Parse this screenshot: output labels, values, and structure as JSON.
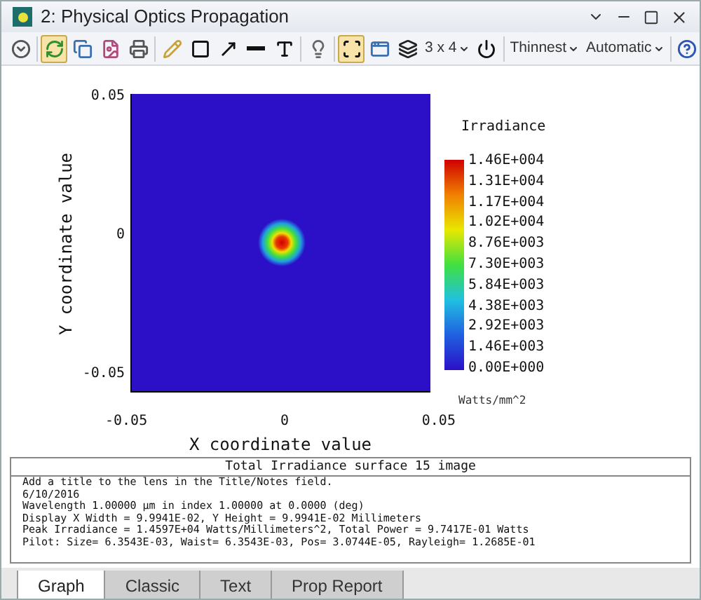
{
  "window": {
    "title": "2: Physical Optics Propagation"
  },
  "toolbar": [
    {
      "kind": "button",
      "selected": false
    },
    {
      "kind": "separator"
    },
    {
      "kind": "button",
      "selected": true
    },
    {
      "kind": "button",
      "selected": false
    },
    {
      "kind": "button",
      "selected": false
    },
    {
      "kind": "button",
      "selected": false
    },
    {
      "kind": "separator"
    },
    {
      "kind": "button",
      "selected": false
    },
    {
      "kind": "button",
      "selected": false
    },
    {
      "kind": "button",
      "selected": false
    },
    {
      "kind": "button",
      "selected": false
    },
    {
      "kind": "button",
      "selected": false
    },
    {
      "kind": "separator"
    },
    {
      "kind": "button",
      "selected": false
    },
    {
      "kind": "separator"
    },
    {
      "kind": "button",
      "selected": true
    },
    {
      "kind": "button",
      "selected": false
    },
    {
      "kind": "button",
      "selected": false
    },
    {
      "kind": "dropdown",
      "label": "3 x 4"
    },
    {
      "kind": "button",
      "selected": false
    },
    {
      "kind": "separator"
    },
    {
      "kind": "dropdown",
      "label": "Thinnest"
    },
    {
      "kind": "dropdown",
      "label": "Automatic"
    },
    {
      "kind": "separator"
    },
    {
      "kind": "button",
      "selected": false
    }
  ],
  "plot": {
    "xlabel": "X coordinate value",
    "ylabel": "Y coordinate value",
    "xticks": [
      "-0.05",
      "0",
      "0.05"
    ],
    "yticks": [
      "0.05",
      "0",
      "-0.05"
    ],
    "colorbar": {
      "title": "Irradiance",
      "labels": [
        "1.46E+004",
        "1.31E+004",
        "1.17E+004",
        "1.02E+004",
        "8.76E+003",
        "7.30E+003",
        "5.84E+003",
        "4.38E+003",
        "2.92E+003",
        "1.46E+003",
        "0.00E+000"
      ],
      "unit": "Watts/mm^2"
    }
  },
  "text_panel": {
    "title": "Total Irradiance surface 15 image",
    "lines": [
      "Add a title to the lens in the Title/Notes field.",
      "6/10/2016",
      "Wavelength 1.00000 µm in index 1.00000 at 0.0000 (deg)",
      "Display X Width = 9.9941E-02, Y Height = 9.9941E-02 Millimeters",
      "Peak Irradiance = 1.4597E+04 Watts/Millimeters^2, Total Power = 9.7417E-01 Watts",
      "Pilot: Size= 6.3543E-03, Waist= 6.3543E-03, Pos= 3.0744E-05, Rayleigh= 1.2685E-01"
    ]
  },
  "tabs": [
    {
      "label": "Graph",
      "selected": true
    },
    {
      "label": "Classic",
      "selected": false
    },
    {
      "label": "Text",
      "selected": false
    },
    {
      "label": "Prop Report",
      "selected": false
    }
  ]
}
